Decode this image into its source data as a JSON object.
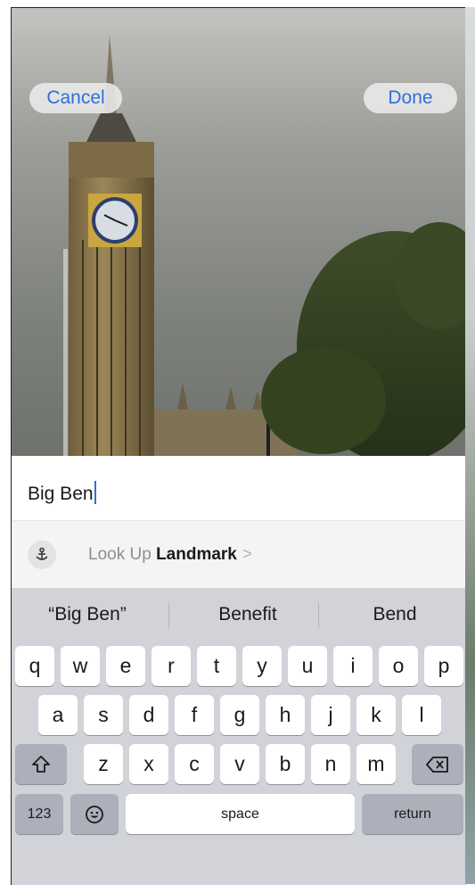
{
  "header": {
    "cancel_label": "Cancel",
    "done_label": "Done"
  },
  "photo": {
    "subject_icon": "landmark-photo"
  },
  "text_field": {
    "value": "Big Ben"
  },
  "lookup": {
    "icon": "landmark-icon",
    "prefix": "Look Up",
    "bold": "Landmark",
    "chevron": ">"
  },
  "keyboard": {
    "suggestions": [
      "“Big Ben”",
      "Benefit",
      "Bend"
    ],
    "row1": [
      "q",
      "w",
      "e",
      "r",
      "t",
      "y",
      "u",
      "i",
      "o",
      "p"
    ],
    "row2": [
      "a",
      "s",
      "d",
      "f",
      "g",
      "h",
      "j",
      "k",
      "l"
    ],
    "row3": [
      "z",
      "x",
      "c",
      "v",
      "b",
      "n",
      "m"
    ],
    "numbers_label": "123",
    "space_label": "space",
    "return_label": "return"
  },
  "colors": {
    "accent": "#2f6fd8",
    "keyboard_bg": "#d1d3d9"
  }
}
